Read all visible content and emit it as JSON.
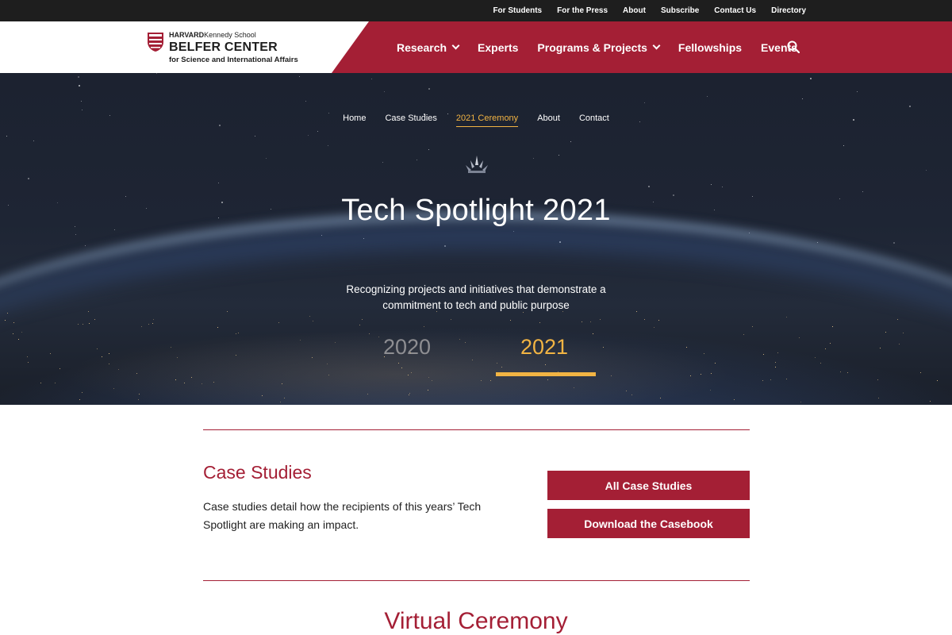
{
  "topbar": {
    "links": [
      "For Students",
      "For the Press",
      "About",
      "Subscribe",
      "Contact Us",
      "Directory"
    ]
  },
  "logo": {
    "line1_a": "HARVARD",
    "line1_b": "Kennedy School",
    "line2": "BELFER CENTER",
    "line3": "for Science and International Affairs"
  },
  "nav": {
    "research": "Research",
    "experts": "Experts",
    "programs": "Programs & Projects",
    "fellowships": "Fellowships",
    "events": "Events"
  },
  "hero": {
    "subnav": [
      "Home",
      "Case Studies",
      "2021 Ceremony",
      "About",
      "Contact"
    ],
    "subnav_active": "2021 Ceremony",
    "title": "Tech Spotlight 2021",
    "subtitle": "Recognizing projects and initiatives that demonstrate a commitment to tech and public purpose",
    "year_2020": "2020",
    "year_2021": "2021"
  },
  "case_studies": {
    "heading": "Case Studies",
    "description": "Case studies detail how the recipients of this years’ Tech Spotlight are making an impact.",
    "all_button": "All Case Studies",
    "download_button": "Download the Casebook"
  },
  "virtual_ceremony": {
    "heading": "Virtual Ceremony"
  },
  "colors": {
    "brand_crimson": "#a41f35",
    "accent_gold": "#f2b443",
    "topbar_bg": "#1e1e1e"
  }
}
